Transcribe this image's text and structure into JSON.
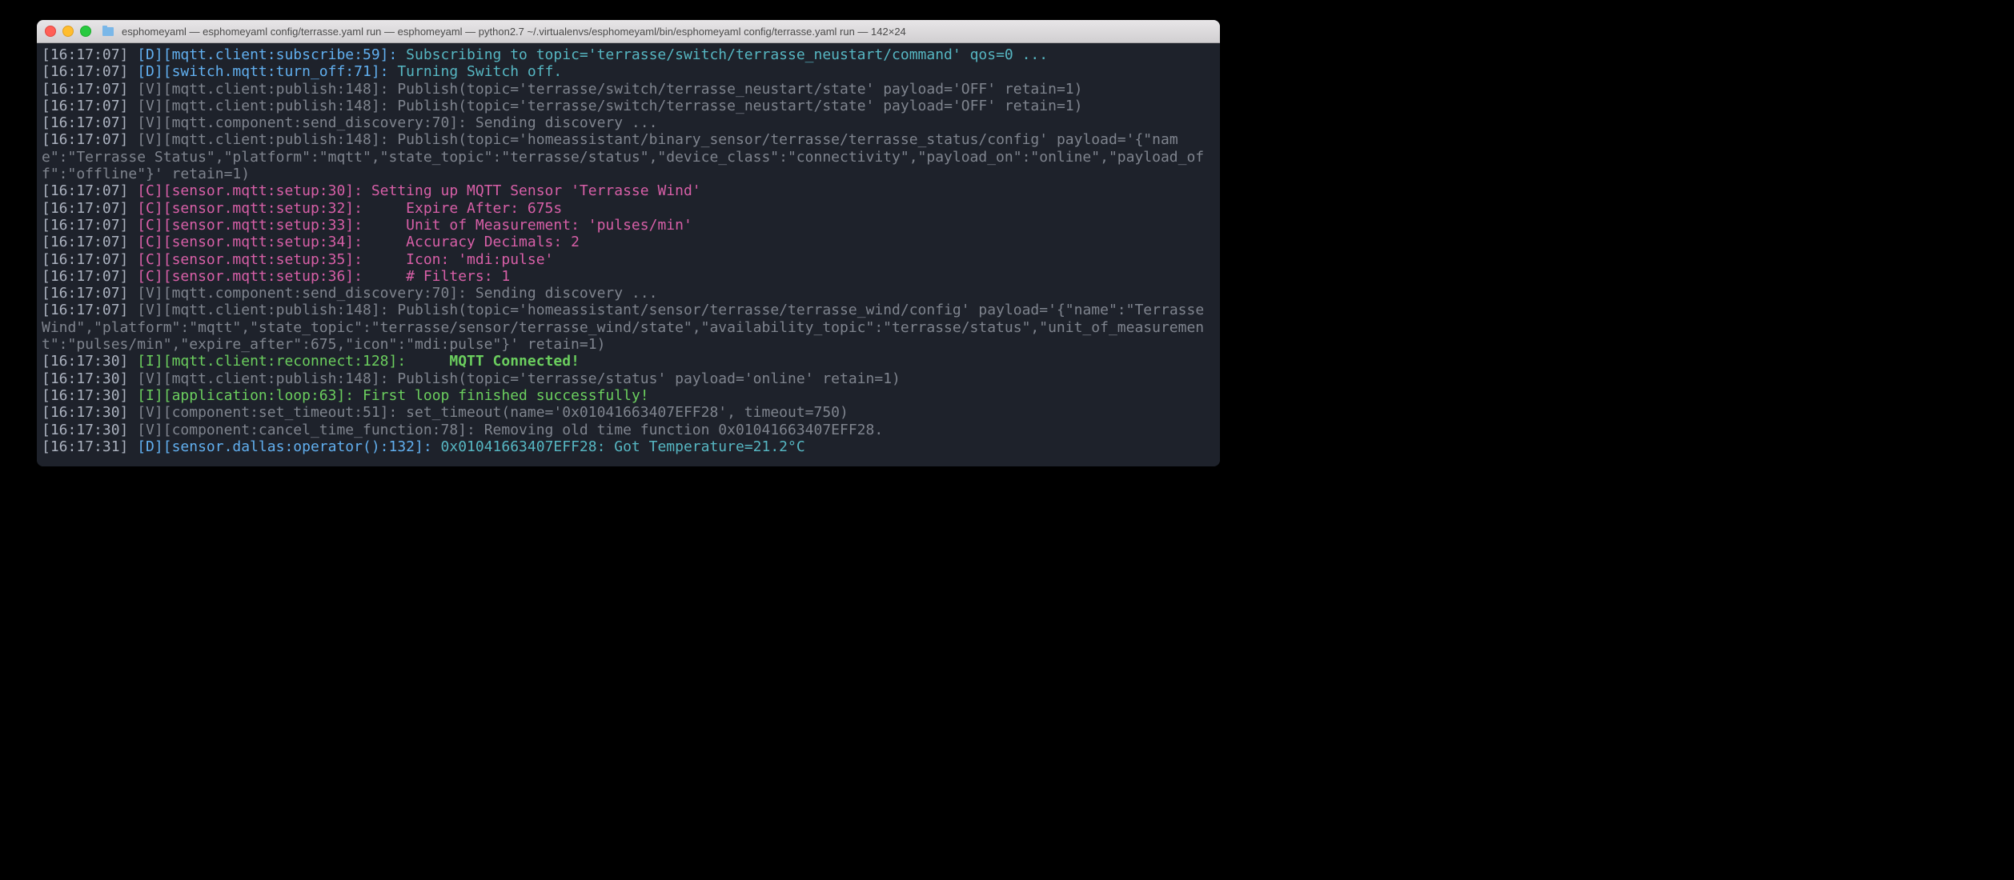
{
  "titlebar": {
    "title": "esphomeyaml — esphomeyaml config/terrasse.yaml run — esphomeyaml — python2.7 ~/.virtualenvs/esphomeyaml/bin/esphomeyaml config/terrasse.yaml run — 142×24"
  },
  "lines": [
    {
      "ts": "[16:17:07]",
      "lvl": "D",
      "tag": "[D][mqtt.client:subscribe:59]:",
      "msg": " Subscribing to topic='terrasse/switch/terrasse_neustart/command' qos=0 ...",
      "color": "cyan"
    },
    {
      "ts": "[16:17:07]",
      "lvl": "D",
      "tag": "[D][switch.mqtt:turn_off:71]:",
      "msg": " Turning Switch off.",
      "color": "cyan"
    },
    {
      "ts": "[16:17:07]",
      "lvl": "V",
      "tag": "[V][mqtt.client:publish:148]:",
      "msg": " Publish(topic='terrasse/switch/terrasse_neustart/state' payload='OFF' retain=1)",
      "color": "grey"
    },
    {
      "ts": "[16:17:07]",
      "lvl": "V",
      "tag": "[V][mqtt.client:publish:148]:",
      "msg": " Publish(topic='terrasse/switch/terrasse_neustart/state' payload='OFF' retain=1)",
      "color": "grey"
    },
    {
      "ts": "[16:17:07]",
      "lvl": "V",
      "tag": "[V][mqtt.component:send_discovery:70]:",
      "msg": " Sending discovery ...",
      "color": "grey"
    },
    {
      "ts": "[16:17:07]",
      "lvl": "V",
      "tag": "[V][mqtt.client:publish:148]:",
      "msg": " Publish(topic='homeassistant/binary_sensor/terrasse/terrasse_status/config' payload='{\"name\":\"Terrasse Status\",\"platform\":\"mqtt\",\"state_topic\":\"terrasse/status\",\"device_class\":\"connectivity\",\"payload_on\":\"online\",\"payload_off\":\"offline\"}' retain=1)",
      "color": "grey"
    },
    {
      "ts": "[16:17:07]",
      "lvl": "C",
      "tag": "[C][sensor.mqtt:setup:30]:",
      "msg": " Setting up MQTT Sensor 'Terrasse Wind'",
      "color": "mag"
    },
    {
      "ts": "[16:17:07]",
      "lvl": "C",
      "tag": "[C][sensor.mqtt:setup:32]:",
      "msg": "     Expire After: 675s",
      "color": "mag"
    },
    {
      "ts": "[16:17:07]",
      "lvl": "C",
      "tag": "[C][sensor.mqtt:setup:33]:",
      "msg": "     Unit of Measurement: 'pulses/min'",
      "color": "mag"
    },
    {
      "ts": "[16:17:07]",
      "lvl": "C",
      "tag": "[C][sensor.mqtt:setup:34]:",
      "msg": "     Accuracy Decimals: 2",
      "color": "mag"
    },
    {
      "ts": "[16:17:07]",
      "lvl": "C",
      "tag": "[C][sensor.mqtt:setup:35]:",
      "msg": "     Icon: 'mdi:pulse'",
      "color": "mag"
    },
    {
      "ts": "[16:17:07]",
      "lvl": "C",
      "tag": "[C][sensor.mqtt:setup:36]:",
      "msg": "     # Filters: 1",
      "color": "mag"
    },
    {
      "ts": "[16:17:07]",
      "lvl": "V",
      "tag": "[V][mqtt.component:send_discovery:70]:",
      "msg": " Sending discovery ...",
      "color": "grey"
    },
    {
      "ts": "[16:17:07]",
      "lvl": "V",
      "tag": "[V][mqtt.client:publish:148]:",
      "msg": " Publish(topic='homeassistant/sensor/terrasse/terrasse_wind/config' payload='{\"name\":\"Terrasse Wind\",\"platform\":\"mqtt\",\"state_topic\":\"terrasse/sensor/terrasse_wind/state\",\"availability_topic\":\"terrasse/status\",\"unit_of_measurement\":\"pulses/min\",\"expire_after\":675,\"icon\":\"mdi:pulse\"}' retain=1)",
      "color": "grey"
    },
    {
      "ts": "[16:17:30]",
      "lvl": "I",
      "tag": "[I][mqtt.client:reconnect:128]:",
      "msg": "     MQTT Connected!",
      "color": "bold-green"
    },
    {
      "ts": "[16:17:30]",
      "lvl": "V",
      "tag": "[V][mqtt.client:publish:148]:",
      "msg": " Publish(topic='terrasse/status' payload='online' retain=1)",
      "color": "grey"
    },
    {
      "ts": "[16:17:30]",
      "lvl": "I",
      "tag": "[I][application:loop:63]:",
      "msg": " First loop finished successfully!",
      "color": "green"
    },
    {
      "ts": "[16:17:30]",
      "lvl": "V",
      "tag": "[V][component:set_timeout:51]:",
      "msg": " set_timeout(name='0x01041663407EFF28', timeout=750)",
      "color": "grey"
    },
    {
      "ts": "[16:17:30]",
      "lvl": "V",
      "tag": "[V][component:cancel_time_function:78]:",
      "msg": " Removing old time function 0x01041663407EFF28.",
      "color": "grey"
    },
    {
      "ts": "[16:17:31]",
      "lvl": "D",
      "tag": "[D][sensor.dallas:operator():132]:",
      "msg": " 0x01041663407EFF28: Got Temperature=21.2°C",
      "color": "cyan"
    }
  ]
}
